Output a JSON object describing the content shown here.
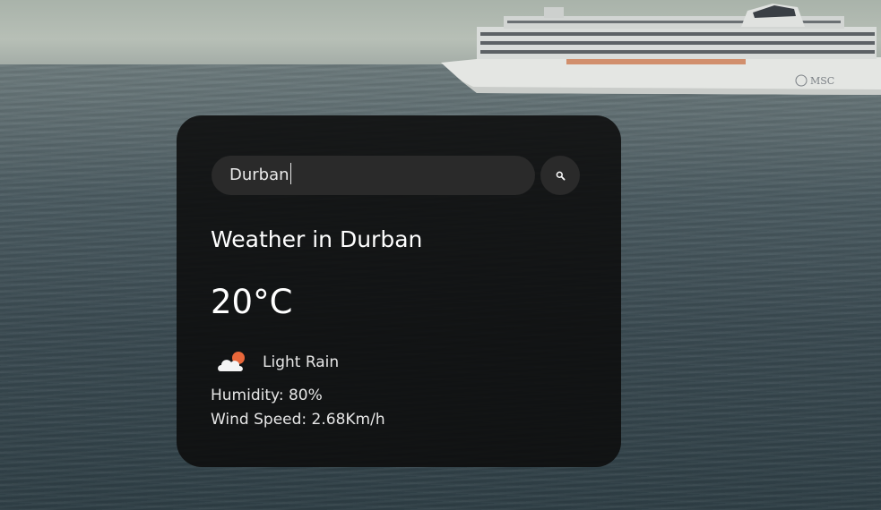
{
  "search": {
    "value": "Durban",
    "button_icon": "search-icon"
  },
  "weather": {
    "title": "Weather in Durban",
    "temperature": "20°C",
    "description": "Light Rain",
    "description_icon": "cloud-sun-icon",
    "humidity": "Humidity: 80%",
    "wind": "Wind Speed: 2.68Km/h"
  },
  "background": {
    "ship_logo": "MSC"
  },
  "colors": {
    "card": "#0d0d0d",
    "input": "#2a2a2a",
    "text": "#ffffff",
    "sun": "#e8673a"
  }
}
